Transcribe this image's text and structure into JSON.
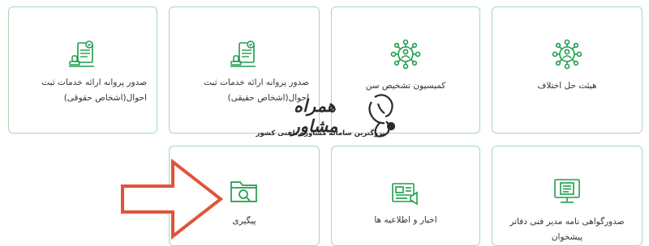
{
  "colors": {
    "accent_green": "#1f9d4d",
    "card_border": "#a9d8b6",
    "arrow_orange": "#e0553a"
  },
  "cards": [
    {
      "label": "صدور پروانه ارائه خدمات ثبت احوال(اشخاص حقوقی)",
      "icon": "certificate-stamp-icon"
    },
    {
      "label": "صدور پروانه ارائه خدمات ثبت احوال(اشخاص حقیقی)",
      "icon": "certificate-stamp-icon"
    },
    {
      "label": "کمیسیون تشخیص سن",
      "icon": "group-gear-icon"
    },
    {
      "label": "هیئت حل اختلاف",
      "icon": "group-gear-icon"
    },
    {
      "label": "پیگیری",
      "icon": "folder-search-icon"
    },
    {
      "label": "اخبار و اطلاعیه ها",
      "icon": "newspaper-megaphone-icon"
    },
    {
      "label": "صدورگواهی نامه مدیر فنی دفاتر پیشخوان",
      "icon": "monitor-document-icon"
    }
  ],
  "watermark": {
    "title": "همراه مشاور",
    "subtitle": "بزرگترین سامانه مشاوره تلفنی کشور"
  }
}
